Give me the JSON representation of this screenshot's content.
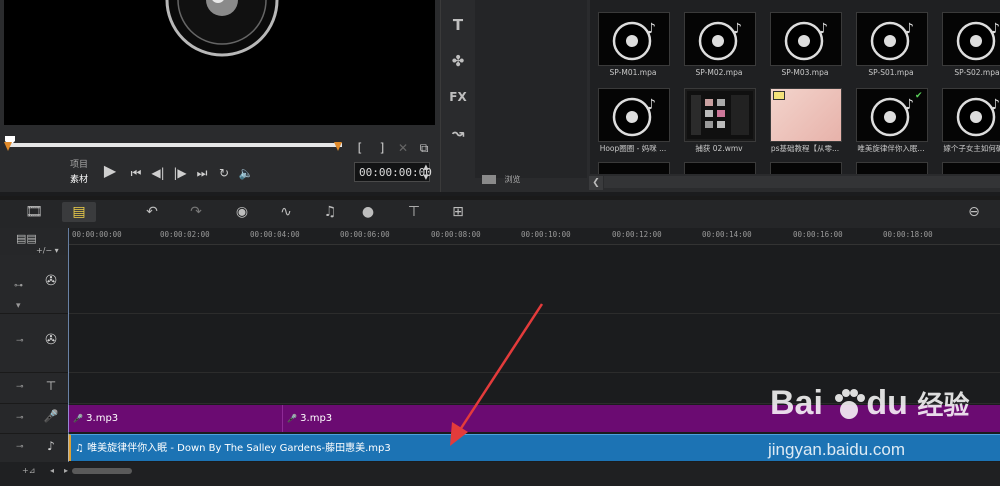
{
  "preview": {
    "mode_project": "项目",
    "mode_clip": "素材",
    "timecode": "00:00:00:00",
    "trim_in": "[",
    "trim_out": "]"
  },
  "side_toolbar": {
    "title_btn": "T",
    "fx_btn": "FX"
  },
  "library": {
    "browse_label": "浏览",
    "items": [
      {
        "label": "SP-M01.mpa",
        "icon": "music-disc-icon"
      },
      {
        "label": "SP-M02.mpa",
        "icon": "music-disc-icon"
      },
      {
        "label": "SP-M03.mpa",
        "icon": "music-disc-icon"
      },
      {
        "label": "SP-S01.mpa",
        "icon": "music-disc-icon"
      },
      {
        "label": "SP-S02.mpa",
        "icon": "music-disc-icon"
      },
      {
        "label": "Hoop圈圈 - 妈咪 ...",
        "icon": "music-disc-icon"
      },
      {
        "label": "捕获 02.wmv",
        "icon": "video-thumb"
      },
      {
        "label": "ps基础教程【从零...",
        "icon": "image-thumb"
      },
      {
        "label": "唯美旋律伴你入眠...",
        "icon": "music-disc-icon"
      },
      {
        "label": "嫁个子女主如何确...",
        "icon": "music-disc-icon"
      }
    ]
  },
  "ruler": {
    "ticks": [
      "00:00:00:00",
      "00:00:02:00",
      "00:00:04:00",
      "00:00:06:00",
      "00:00:08:00",
      "00:00:10:00",
      "00:00:12:00",
      "00:00:14:00",
      "00:00:16:00",
      "00:00:18:00"
    ]
  },
  "tracks": {
    "voice_clip_1": "3.mp3",
    "voice_clip_2": "3.mp3",
    "music_clip": "唯美旋律伴你入眠 - Down By The Salley Gardens-藤田惠美.mp3"
  },
  "watermark": {
    "brand": "Bai",
    "brand2": "du",
    "cn": "经验",
    "url": "jingyan.baidu.com"
  },
  "colors": {
    "voice_track": "#6b0b72",
    "music_track": "#1c73b4",
    "accent": "#e08a2a",
    "annotation_arrow": "#e33b3b"
  }
}
